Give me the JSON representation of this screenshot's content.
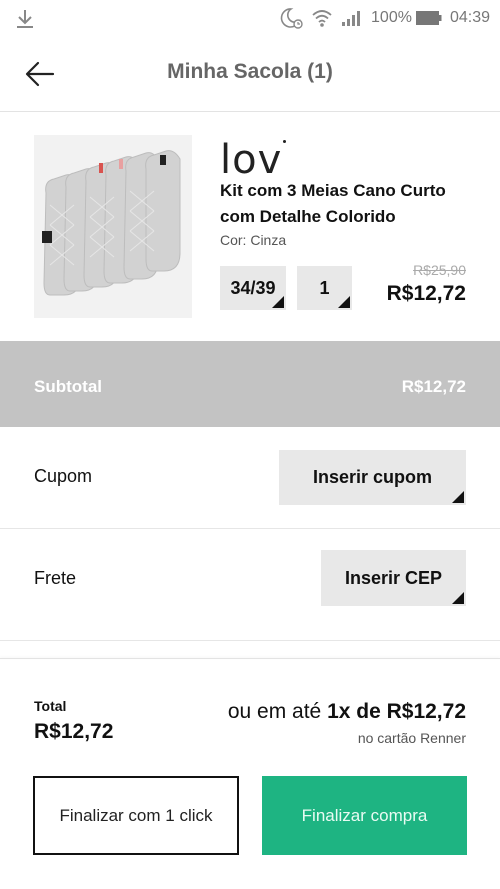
{
  "status_bar": {
    "battery_percent": "100%",
    "time": "04:39",
    "icons": [
      "download-icon",
      "moon-alarm-icon",
      "wifi-icon",
      "signal-icon",
      "battery-icon"
    ]
  },
  "header": {
    "title": "Minha Sacola (1)",
    "back_icon": "arrow-left-icon"
  },
  "product": {
    "brand": "lov",
    "name": "Kit com 3 Meias Cano Curto com Detalhe Colorido",
    "color_label": "Cor: Cinza",
    "size": "34/39",
    "quantity": "1",
    "old_price": "R$25,90",
    "price": "R$12,72"
  },
  "subtotal": {
    "label": "Subtotal",
    "value": "R$12,72"
  },
  "coupon": {
    "label": "Cupom",
    "button": "Inserir cupom"
  },
  "shipping": {
    "label": "Frete",
    "button": "Inserir CEP"
  },
  "totals": {
    "label": "Total",
    "value": "R$12,72",
    "installments_prefix": "ou em até ",
    "installments_value": "1x de R$12,72",
    "card_note": "no cartão Renner"
  },
  "buttons": {
    "one_click": "Finalizar com 1 click",
    "checkout": "Finalizar compra"
  },
  "colors": {
    "accent_green": "#1eb482",
    "subtotal_bar": "#c3c3c3",
    "control_gray": "#e8e8e8"
  }
}
